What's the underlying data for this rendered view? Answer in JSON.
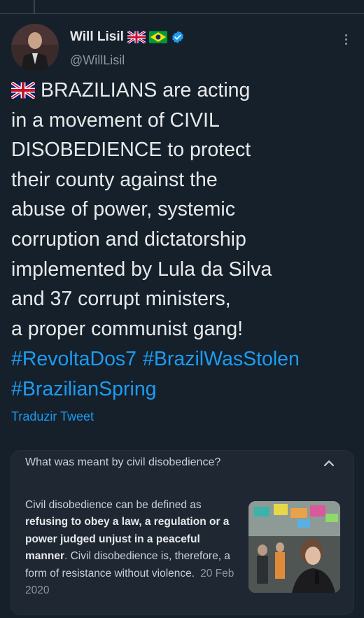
{
  "tweet": {
    "author_name": "Will Lisil",
    "author_handle": "@WillLisil",
    "text": "BRAZILIANS are acting\nin a movement of CIVIL\nDISOBEDIENCE to protect\ntheir county against the\nabuse of power, systemic\ncorruption and dictatorship\nimplemented by Lula da Silva\nand 37 corrupt ministers,\na proper communist gang!",
    "hashtags": [
      "#RevoltaDos7",
      "#BrazilWasStolen",
      "#BrazilianSpring"
    ],
    "translate_label": "Traduzir Tweet"
  },
  "card": {
    "question": "What was meant by civil disobedience?",
    "intro": "Civil disobedience can be defined as ",
    "bold": "refusing to obey a law, a regulation or a power judged unjust in a peaceful manner",
    "rest": ". Civil disobedience is, therefore, a form of resistance without violence.",
    "date": "20 Feb 2020"
  },
  "colors": {
    "background": "#15202b",
    "link": "#1d9bf0",
    "verified": "#1d9bf0"
  },
  "icons": [
    "uk-flag-icon",
    "brazil-flag-icon",
    "verified-badge-icon",
    "more-options-icon",
    "chevron-up-icon"
  ]
}
